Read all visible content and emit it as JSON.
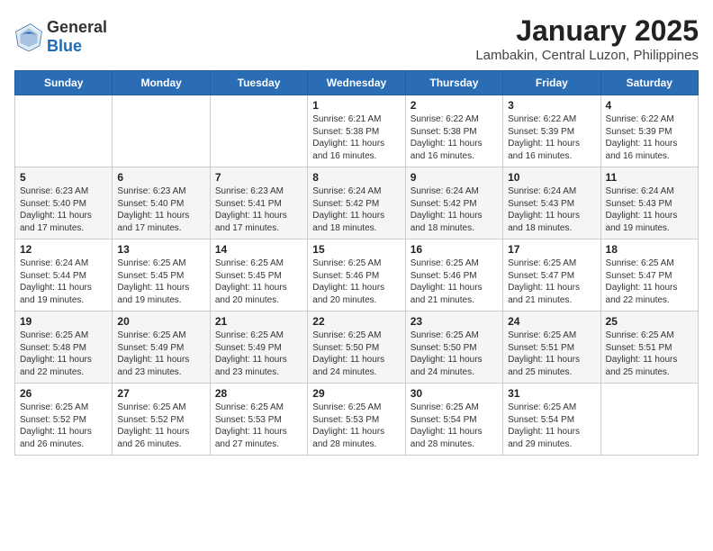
{
  "header": {
    "logo_general": "General",
    "logo_blue": "Blue",
    "title": "January 2025",
    "subtitle": "Lambakin, Central Luzon, Philippines"
  },
  "calendar": {
    "weekdays": [
      "Sunday",
      "Monday",
      "Tuesday",
      "Wednesday",
      "Thursday",
      "Friday",
      "Saturday"
    ],
    "weeks": [
      [
        {
          "day": "",
          "info": ""
        },
        {
          "day": "",
          "info": ""
        },
        {
          "day": "",
          "info": ""
        },
        {
          "day": "1",
          "info": "Sunrise: 6:21 AM\nSunset: 5:38 PM\nDaylight: 11 hours\nand 16 minutes."
        },
        {
          "day": "2",
          "info": "Sunrise: 6:22 AM\nSunset: 5:38 PM\nDaylight: 11 hours\nand 16 minutes."
        },
        {
          "day": "3",
          "info": "Sunrise: 6:22 AM\nSunset: 5:39 PM\nDaylight: 11 hours\nand 16 minutes."
        },
        {
          "day": "4",
          "info": "Sunrise: 6:22 AM\nSunset: 5:39 PM\nDaylight: 11 hours\nand 16 minutes."
        }
      ],
      [
        {
          "day": "5",
          "info": "Sunrise: 6:23 AM\nSunset: 5:40 PM\nDaylight: 11 hours\nand 17 minutes."
        },
        {
          "day": "6",
          "info": "Sunrise: 6:23 AM\nSunset: 5:40 PM\nDaylight: 11 hours\nand 17 minutes."
        },
        {
          "day": "7",
          "info": "Sunrise: 6:23 AM\nSunset: 5:41 PM\nDaylight: 11 hours\nand 17 minutes."
        },
        {
          "day": "8",
          "info": "Sunrise: 6:24 AM\nSunset: 5:42 PM\nDaylight: 11 hours\nand 18 minutes."
        },
        {
          "day": "9",
          "info": "Sunrise: 6:24 AM\nSunset: 5:42 PM\nDaylight: 11 hours\nand 18 minutes."
        },
        {
          "day": "10",
          "info": "Sunrise: 6:24 AM\nSunset: 5:43 PM\nDaylight: 11 hours\nand 18 minutes."
        },
        {
          "day": "11",
          "info": "Sunrise: 6:24 AM\nSunset: 5:43 PM\nDaylight: 11 hours\nand 19 minutes."
        }
      ],
      [
        {
          "day": "12",
          "info": "Sunrise: 6:24 AM\nSunset: 5:44 PM\nDaylight: 11 hours\nand 19 minutes."
        },
        {
          "day": "13",
          "info": "Sunrise: 6:25 AM\nSunset: 5:45 PM\nDaylight: 11 hours\nand 19 minutes."
        },
        {
          "day": "14",
          "info": "Sunrise: 6:25 AM\nSunset: 5:45 PM\nDaylight: 11 hours\nand 20 minutes."
        },
        {
          "day": "15",
          "info": "Sunrise: 6:25 AM\nSunset: 5:46 PM\nDaylight: 11 hours\nand 20 minutes."
        },
        {
          "day": "16",
          "info": "Sunrise: 6:25 AM\nSunset: 5:46 PM\nDaylight: 11 hours\nand 21 minutes."
        },
        {
          "day": "17",
          "info": "Sunrise: 6:25 AM\nSunset: 5:47 PM\nDaylight: 11 hours\nand 21 minutes."
        },
        {
          "day": "18",
          "info": "Sunrise: 6:25 AM\nSunset: 5:47 PM\nDaylight: 11 hours\nand 22 minutes."
        }
      ],
      [
        {
          "day": "19",
          "info": "Sunrise: 6:25 AM\nSunset: 5:48 PM\nDaylight: 11 hours\nand 22 minutes."
        },
        {
          "day": "20",
          "info": "Sunrise: 6:25 AM\nSunset: 5:49 PM\nDaylight: 11 hours\nand 23 minutes."
        },
        {
          "day": "21",
          "info": "Sunrise: 6:25 AM\nSunset: 5:49 PM\nDaylight: 11 hours\nand 23 minutes."
        },
        {
          "day": "22",
          "info": "Sunrise: 6:25 AM\nSunset: 5:50 PM\nDaylight: 11 hours\nand 24 minutes."
        },
        {
          "day": "23",
          "info": "Sunrise: 6:25 AM\nSunset: 5:50 PM\nDaylight: 11 hours\nand 24 minutes."
        },
        {
          "day": "24",
          "info": "Sunrise: 6:25 AM\nSunset: 5:51 PM\nDaylight: 11 hours\nand 25 minutes."
        },
        {
          "day": "25",
          "info": "Sunrise: 6:25 AM\nSunset: 5:51 PM\nDaylight: 11 hours\nand 25 minutes."
        }
      ],
      [
        {
          "day": "26",
          "info": "Sunrise: 6:25 AM\nSunset: 5:52 PM\nDaylight: 11 hours\nand 26 minutes."
        },
        {
          "day": "27",
          "info": "Sunrise: 6:25 AM\nSunset: 5:52 PM\nDaylight: 11 hours\nand 26 minutes."
        },
        {
          "day": "28",
          "info": "Sunrise: 6:25 AM\nSunset: 5:53 PM\nDaylight: 11 hours\nand 27 minutes."
        },
        {
          "day": "29",
          "info": "Sunrise: 6:25 AM\nSunset: 5:53 PM\nDaylight: 11 hours\nand 28 minutes."
        },
        {
          "day": "30",
          "info": "Sunrise: 6:25 AM\nSunset: 5:54 PM\nDaylight: 11 hours\nand 28 minutes."
        },
        {
          "day": "31",
          "info": "Sunrise: 6:25 AM\nSunset: 5:54 PM\nDaylight: 11 hours\nand 29 minutes."
        },
        {
          "day": "",
          "info": ""
        }
      ]
    ]
  }
}
